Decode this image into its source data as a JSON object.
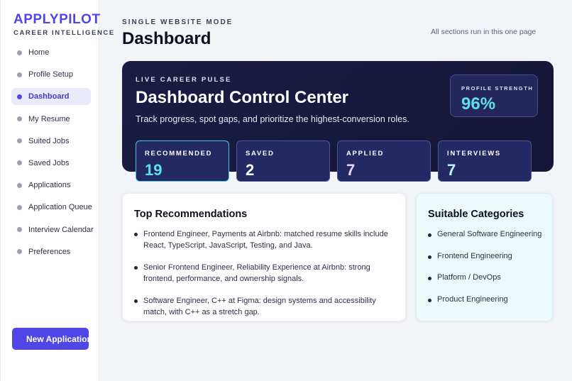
{
  "sidebar": {
    "brand": "APPLYPILOT",
    "brand_sub": "CAREER INTELLIGENCE",
    "items": [
      {
        "label": "Home"
      },
      {
        "label": "Profile Setup"
      },
      {
        "label": "Dashboard",
        "active": true
      },
      {
        "label": "My Resume"
      },
      {
        "label": "Suited Jobs"
      },
      {
        "label": "Saved Jobs"
      },
      {
        "label": "Applications"
      },
      {
        "label": "Application Queue"
      },
      {
        "label": "Interview Calendar"
      },
      {
        "label": "Preferences"
      }
    ],
    "new_application_label": "New Application"
  },
  "header": {
    "eyebrow": "SINGLE WEBSITE MODE",
    "title": "Dashboard",
    "note": "All sections run in this one page"
  },
  "hero": {
    "eyebrow": "LIVE CAREER PULSE",
    "title": "Dashboard Control Center",
    "subtitle": "Track progress, spot gaps, and prioritize the highest-conversion roles.",
    "profile_strength": {
      "label": "PROFILE STRENGTH",
      "value": "96%"
    },
    "stats": [
      {
        "label": "RECOMMENDED",
        "value": "19",
        "color": "#5ee0f0"
      },
      {
        "label": "SAVED",
        "value": "2",
        "color": "#ffffff"
      },
      {
        "label": "APPLIED",
        "value": "7",
        "color": "#e9d5ff"
      },
      {
        "label": "INTERVIEWS",
        "value": "7",
        "color": "#bff2ff"
      }
    ]
  },
  "recommendations": {
    "title": "Top Recommendations",
    "items": [
      "Frontend Engineer, Payments at Airbnb: matched resume skills include React, TypeScript, JavaScript, Testing, and Java.",
      "Senior Frontend Engineer, Reliability Experience at Airbnb: strong frontend, performance, and ownership signals.",
      "Software Engineer, C++ at Figma: design systems and accessibility match, with C++ as a stretch gap."
    ]
  },
  "categories": {
    "title": "Suitable Categories",
    "items": [
      "General Software Engineering",
      "Frontend Engineering",
      "Platform / DevOps",
      "Product Engineering"
    ]
  },
  "colors": {
    "accent": "#4f46e5",
    "hero_bg": "#1b1c45",
    "cyan": "#5ee0f0"
  }
}
